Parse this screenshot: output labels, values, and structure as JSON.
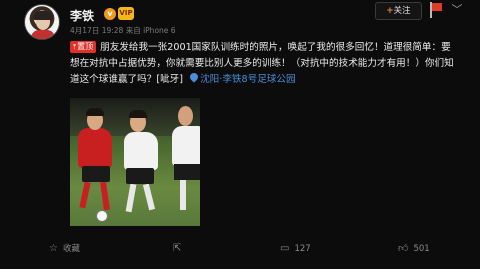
{
  "header": {
    "username": "李铁",
    "v_badge": "v",
    "vip_badge": "VIP",
    "meta": "4月17日 19:28 来自 iPhone 6",
    "follow_plus": "+",
    "follow_label": "关注",
    "more_icon": "chevron-down-icon"
  },
  "post": {
    "pin_label": "置顶",
    "text": "朋友发给我一张2001国家队训练时的照片，唤起了我的很多回忆！道理很简单：要想在对抗中占据优势，你就需要比别人更多的训练！（对抗中的技术能力才有用！）你们知道这个球谁赢了吗？[呲牙]",
    "location": "沈阳·李铁8号足球公园"
  },
  "actions": {
    "favorite": "收藏",
    "share": "",
    "comment_count": "127",
    "like_count": "501"
  },
  "colors": {
    "accent_orange": "#f2872b",
    "link_blue": "#4a8fd8",
    "pin_red": "#e0302a"
  }
}
